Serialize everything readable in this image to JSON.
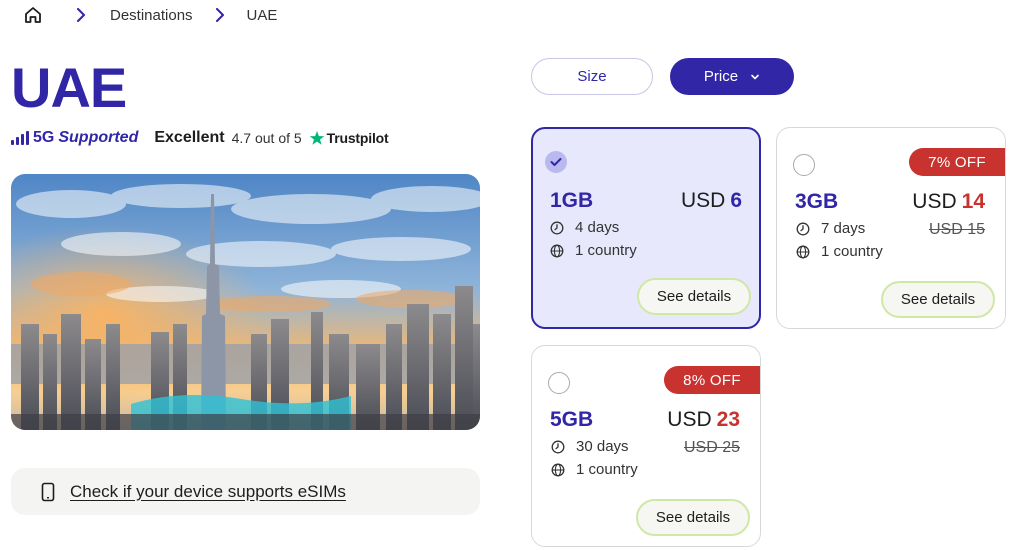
{
  "breadcrumb": {
    "home_icon": "home-icon",
    "items": [
      "Destinations",
      "UAE"
    ]
  },
  "title": "UAE",
  "network": {
    "label_5g": "5G",
    "label_supported": "Supported",
    "icon": "signal-bars-icon"
  },
  "trustpilot": {
    "rating_word": "Excellent",
    "score_text": "4.7 out of 5",
    "brand": "Trustpilot",
    "star_color": "#00b67a"
  },
  "hero": {
    "icon": "dubai-skyline-image"
  },
  "esim_check": {
    "label": "Check if your device supports eSIMs",
    "icon": "phone-icon"
  },
  "sort": {
    "size_label": "Size",
    "price_label": "Price"
  },
  "plans": [
    {
      "size": "1GB",
      "currency": "USD",
      "price": "6",
      "old_price": "",
      "discount": "",
      "duration": "4 days",
      "coverage": "1 country",
      "details_label": "See details",
      "selected": true
    },
    {
      "size": "3GB",
      "currency": "USD",
      "price": "14",
      "old_price": "USD 15",
      "discount": "7% OFF",
      "duration": "7 days",
      "coverage": "1 country",
      "details_label": "See details",
      "selected": false
    },
    {
      "size": "5GB",
      "currency": "USD",
      "price": "23",
      "old_price": "USD 25",
      "discount": "8% OFF",
      "duration": "30 days",
      "coverage": "1 country",
      "details_label": "See details",
      "selected": false
    }
  ],
  "colors": {
    "brand": "#3126a6",
    "sale": "#c8322f",
    "selected_bg": "#e8e8fd",
    "details_border": "#cfe8a6"
  }
}
